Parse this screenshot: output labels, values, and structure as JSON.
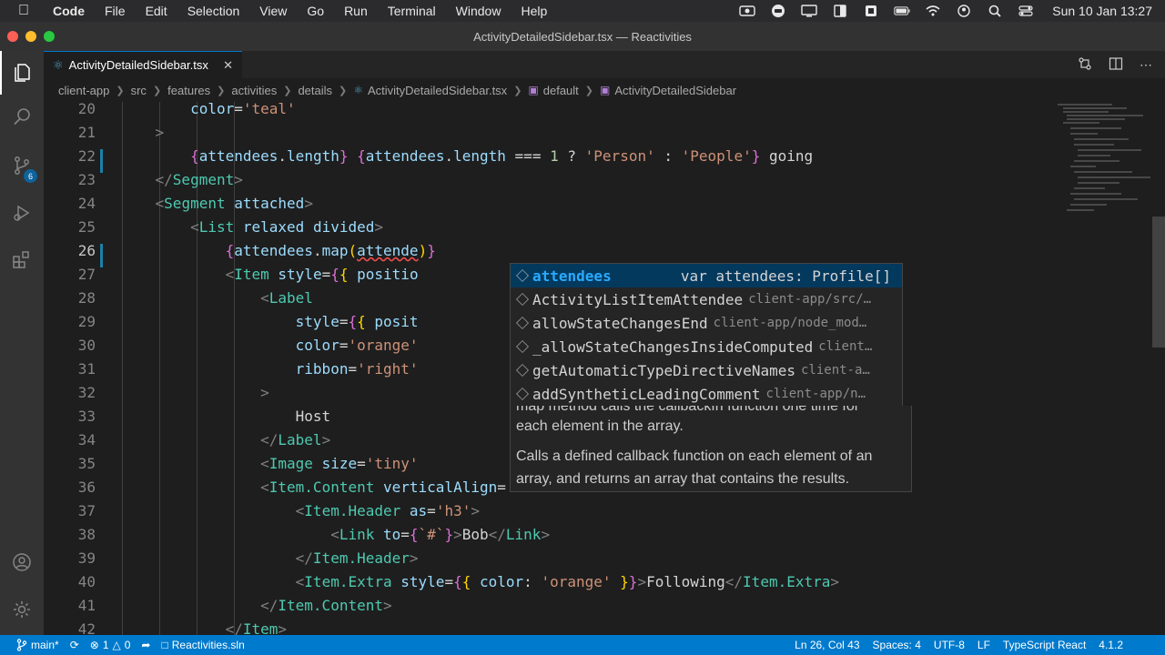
{
  "menubar": {
    "app": "Code",
    "items": [
      "File",
      "Edit",
      "Selection",
      "View",
      "Go",
      "Run",
      "Terminal",
      "Window",
      "Help"
    ],
    "clock": "Sun 10 Jan  13:27"
  },
  "window": {
    "title": "ActivityDetailedSidebar.tsx — Reactivities"
  },
  "activitybar": {
    "scm_badge": "6"
  },
  "tab": {
    "label": "ActivityDetailedSidebar.tsx"
  },
  "breadcrumb": {
    "items": [
      "client-app",
      "src",
      "features",
      "activities",
      "details",
      "ActivityDetailedSidebar.tsx",
      "default",
      "ActivityDetailedSidebar"
    ]
  },
  "editor": {
    "lines": [
      {
        "n": "20"
      },
      {
        "n": "21"
      },
      {
        "n": "22"
      },
      {
        "n": "23"
      },
      {
        "n": "24"
      },
      {
        "n": "25"
      },
      {
        "n": "26"
      },
      {
        "n": "27"
      },
      {
        "n": "28"
      },
      {
        "n": "29"
      },
      {
        "n": "30"
      },
      {
        "n": "31"
      },
      {
        "n": "32"
      },
      {
        "n": "33"
      },
      {
        "n": "34"
      },
      {
        "n": "35"
      },
      {
        "n": "36"
      },
      {
        "n": "37"
      },
      {
        "n": "38"
      },
      {
        "n": "39"
      },
      {
        "n": "40"
      },
      {
        "n": "41"
      },
      {
        "n": "42"
      }
    ]
  },
  "suggest": {
    "items": [
      {
        "label": "attendees",
        "type": "var attendees: Profile[]"
      },
      {
        "label": "ActivityListItemAttendee",
        "detail": "client-app/src/…"
      },
      {
        "label": "allowStateChangesEnd",
        "detail": "client-app/node_mod…"
      },
      {
        "label": "_allowStateChangesInsideComputed",
        "detail": "client…"
      },
      {
        "label": "getAutomaticTypeDirectiveNames",
        "detail": "client-a…"
      },
      {
        "label": "addSyntheticLeadingComment",
        "detail": "client-app/n…"
      }
    ]
  },
  "doc": {
    "cut_line": "map method calls the callbackfn function one time for",
    "line2": "each element in the array.",
    "para": "Calls a defined callback function on each element of an array, and returns an array that contains the results."
  },
  "statusbar": {
    "branch": "main*",
    "errors": "1",
    "warnings": "0",
    "solution": "Reactivities.sln",
    "position": "Ln 26, Col 43",
    "spaces": "Spaces: 4",
    "encoding": "UTF-8",
    "eol": "LF",
    "language": "TypeScript React",
    "version": "4.1.2"
  }
}
